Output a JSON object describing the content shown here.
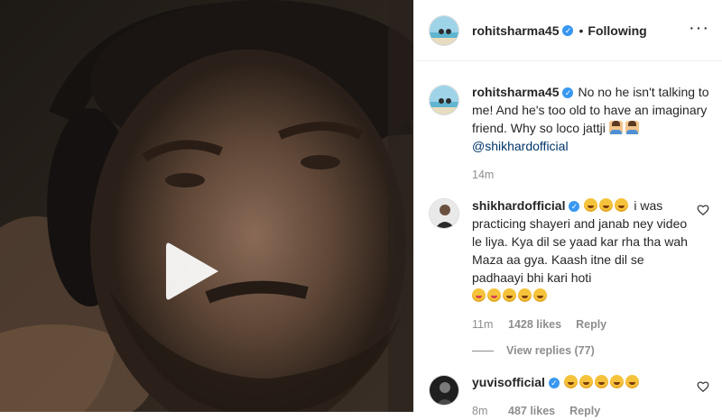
{
  "header": {
    "username": "rohitsharma45",
    "dot": "•",
    "follow_state": "Following",
    "more": "···"
  },
  "caption": {
    "username": "rohitsharma45",
    "text": "No no he isn't talking to me! And he's too old to have an imaginary friend. Why so loco jattji",
    "mention": "@shikhardofficial",
    "time": "14m"
  },
  "comments": [
    {
      "username": "shikhardofficial",
      "text": "i was practicing shayeri and janab ney video le liya. Kya dil se yaad kar rha tha wah Maza aa gya. Kaash itne dil se padhaayi bhi kari hoti",
      "time": "11m",
      "likes": "1428 likes",
      "reply": "Reply",
      "view_replies": "View replies (77)"
    },
    {
      "username": "yuvisofficial",
      "text": "",
      "time": "8m",
      "likes": "487 likes",
      "reply": "Reply"
    }
  ],
  "icons": {
    "play": "play-icon",
    "verified": "verified-badge-icon",
    "heart": "heart-icon",
    "more": "more-options-icon"
  },
  "colors": {
    "verified": "#3897f0",
    "mention": "#003569",
    "meta": "#8e8e8e",
    "text": "#262626"
  }
}
